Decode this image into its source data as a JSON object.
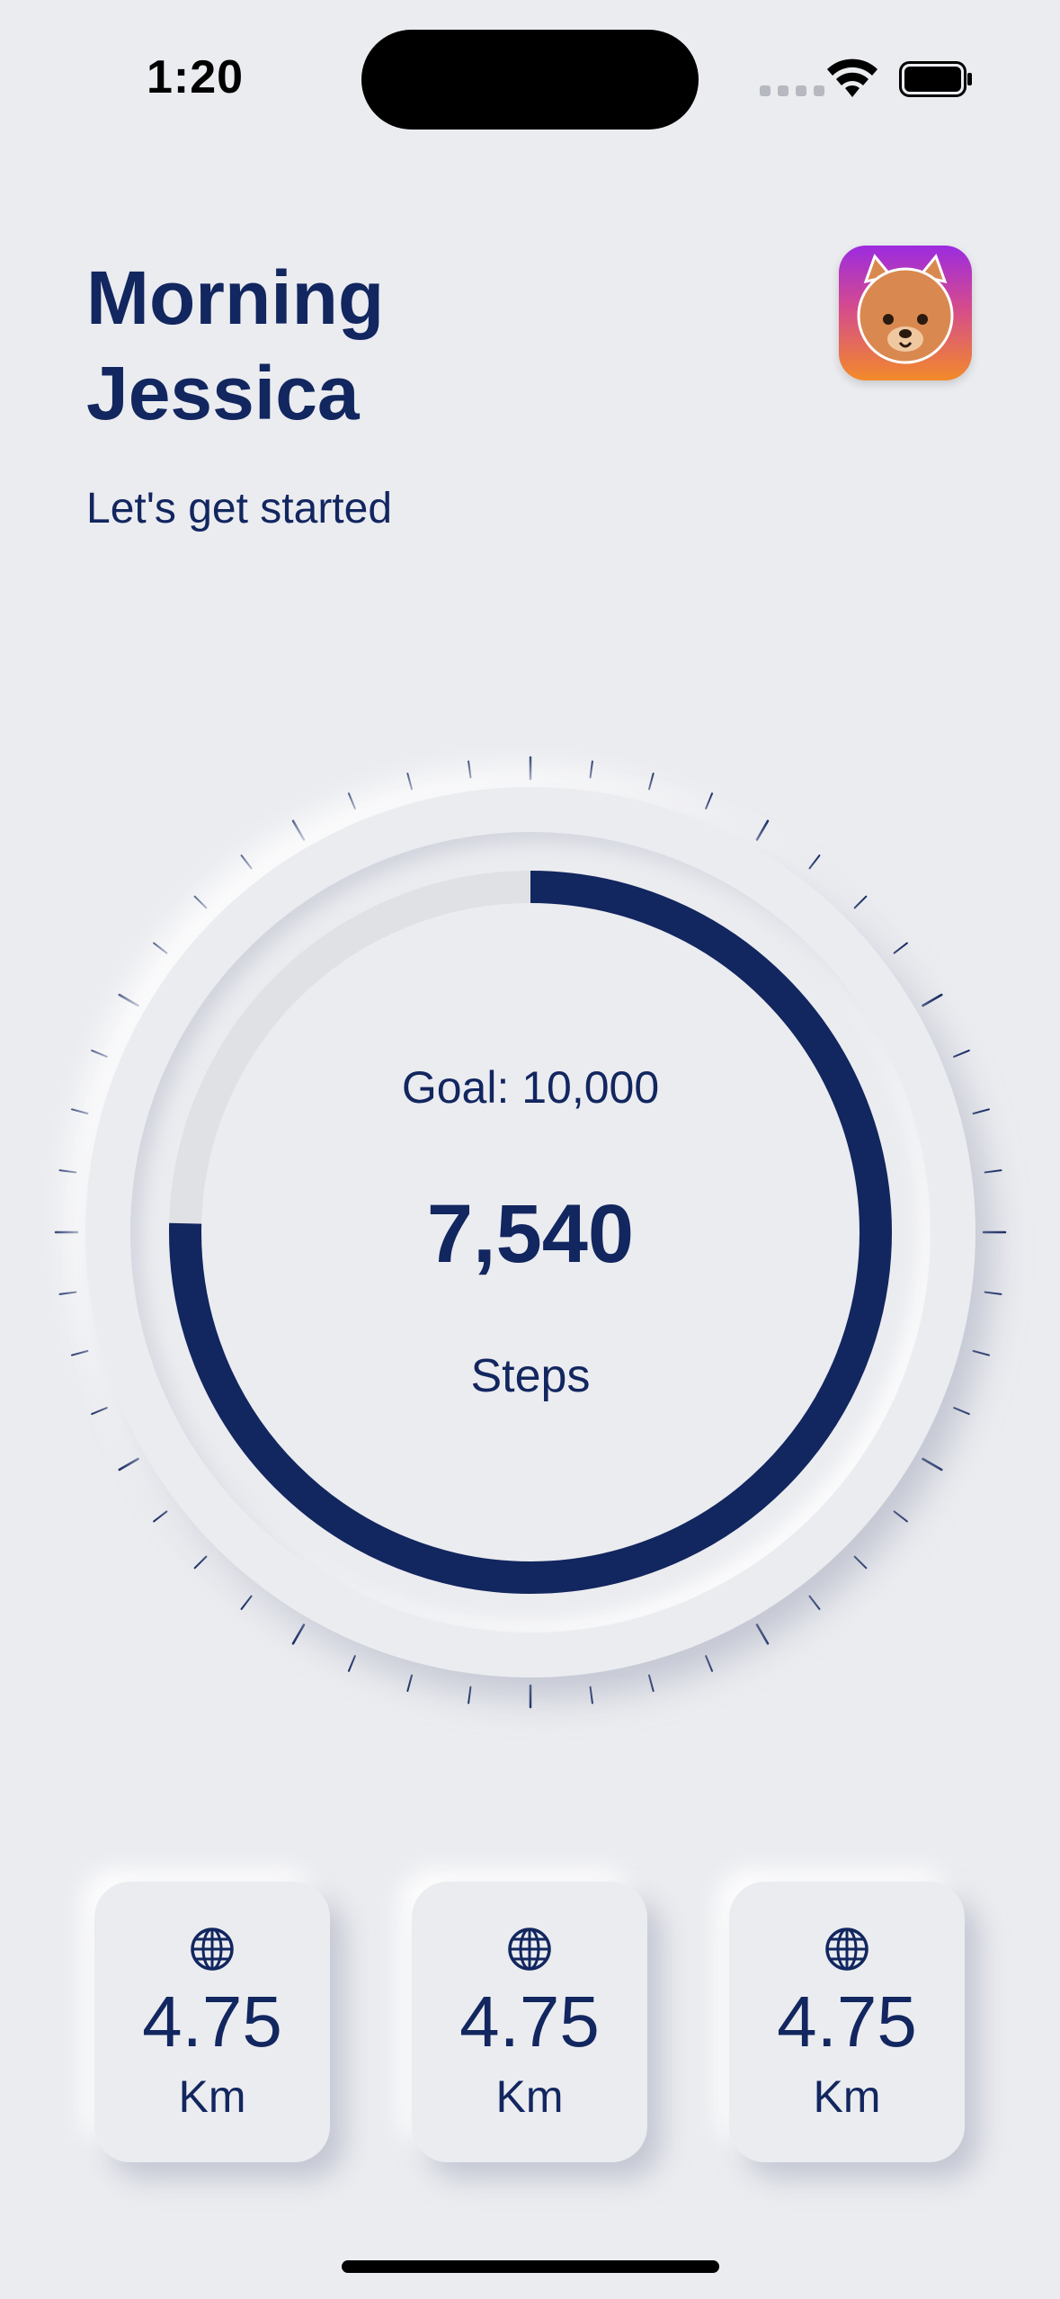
{
  "status": {
    "time": "1:20"
  },
  "header": {
    "greeting_line1": "Morning",
    "greeting_line2": "Jessica",
    "subtitle": "Let's get started"
  },
  "steps": {
    "goal_label": "Goal: 10,000",
    "value": "7,540",
    "label": "Steps",
    "progress": 0.754
  },
  "cards": [
    {
      "icon": "globe-icon",
      "value": "4.75",
      "unit": "Km"
    },
    {
      "icon": "globe-icon",
      "value": "4.75",
      "unit": "Km"
    },
    {
      "icon": "globe-icon",
      "value": "4.75",
      "unit": "Km"
    }
  ],
  "colors": {
    "background": "#ebecf0",
    "accent": "#12265f",
    "track": "#e0e1e5"
  }
}
